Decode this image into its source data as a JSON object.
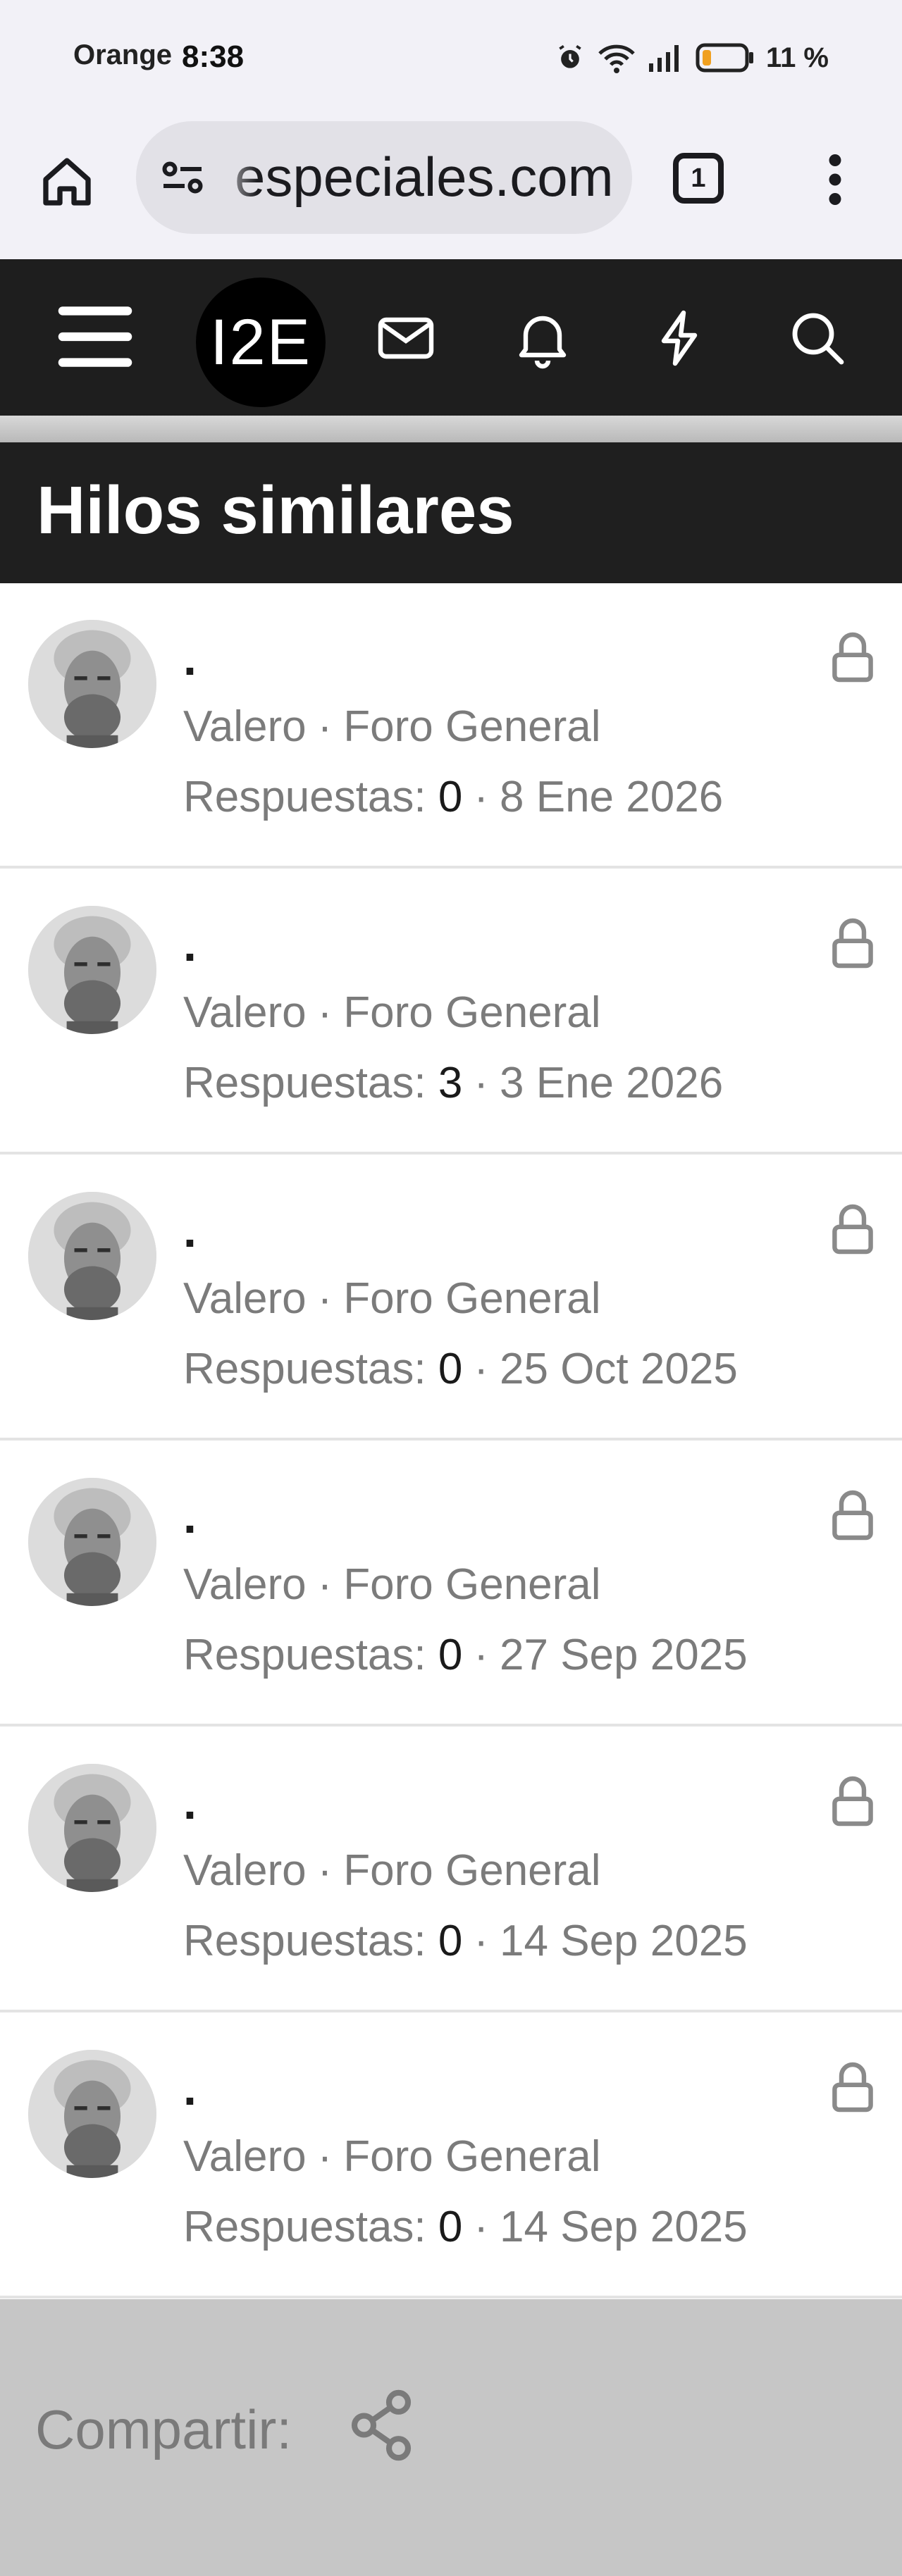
{
  "status_bar": {
    "carrier": "Orange",
    "time": "8:38",
    "battery": "11 %"
  },
  "browser": {
    "url_visible": "especiales.com",
    "tab_count": "1"
  },
  "site_nav": {
    "logo_text": "I2E"
  },
  "section": {
    "title": "Hilos similares"
  },
  "threads": [
    {
      "title": ".",
      "author": "Valero",
      "forum": "Foro General",
      "replies_label": "Respuestas:",
      "replies": "0",
      "date": "8 Ene 2026"
    },
    {
      "title": ".",
      "author": "Valero",
      "forum": "Foro General",
      "replies_label": "Respuestas:",
      "replies": "3",
      "date": "3 Ene 2026"
    },
    {
      "title": ".",
      "author": "Valero",
      "forum": "Foro General",
      "replies_label": "Respuestas:",
      "replies": "0",
      "date": "25 Oct 2025"
    },
    {
      "title": ".",
      "author": "Valero",
      "forum": "Foro General",
      "replies_label": "Respuestas:",
      "replies": "0",
      "date": "27 Sep 2025"
    },
    {
      "title": ".",
      "author": "Valero",
      "forum": "Foro General",
      "replies_label": "Respuestas:",
      "replies": "0",
      "date": "14 Sep 2025"
    },
    {
      "title": ".",
      "author": "Valero",
      "forum": "Foro General",
      "replies_label": "Respuestas:",
      "replies": "0",
      "date": "14 Sep 2025"
    }
  ],
  "share": {
    "label": "Compartir:"
  },
  "icons": {
    "home": "home-icon",
    "site_settings": "site-settings-icon",
    "menu": "more-vert-icon",
    "hamburger": "hamburger-icon",
    "inbox": "mail-icon",
    "alerts": "bell-icon",
    "whats_new": "bolt-icon",
    "search": "search-icon",
    "lock": "lock-icon",
    "share": "share-icon"
  }
}
